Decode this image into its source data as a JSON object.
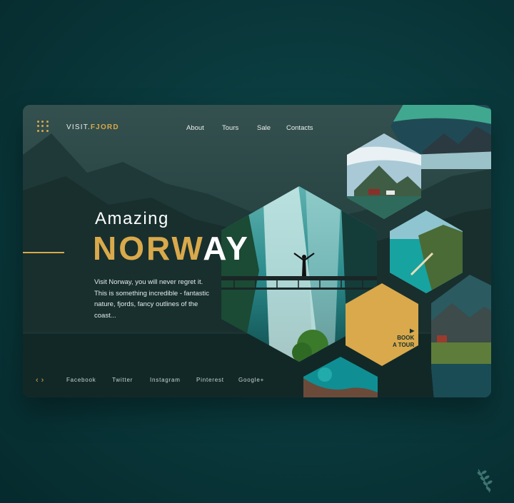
{
  "brand": {
    "prefix": "VISIT.",
    "highlight": "FJORD"
  },
  "nav": [
    {
      "label": "About"
    },
    {
      "label": "Tours"
    },
    {
      "label": "Sale"
    },
    {
      "label": "Contacts"
    }
  ],
  "hero": {
    "small_title": "Amazing",
    "big_title_gold": "NORW",
    "big_title_white": "AY",
    "description": "Visit Norway, you will never regret it. This is something incredible - fantastic nature, fjords, fancy outlines of the coast..."
  },
  "cta": {
    "line1": "BOOK",
    "line2": "A TOUR",
    "icon": "play-icon"
  },
  "pager": {
    "prev": "‹",
    "next": "›"
  },
  "social": [
    {
      "label": "Facebook"
    },
    {
      "label": "Twitter"
    },
    {
      "label": "Instagram"
    },
    {
      "label": "Pinterest"
    },
    {
      "label": "Google+"
    }
  ],
  "colors": {
    "accent": "#d9a94b",
    "card": "#1f3a39",
    "background": "#0a3a3d"
  }
}
